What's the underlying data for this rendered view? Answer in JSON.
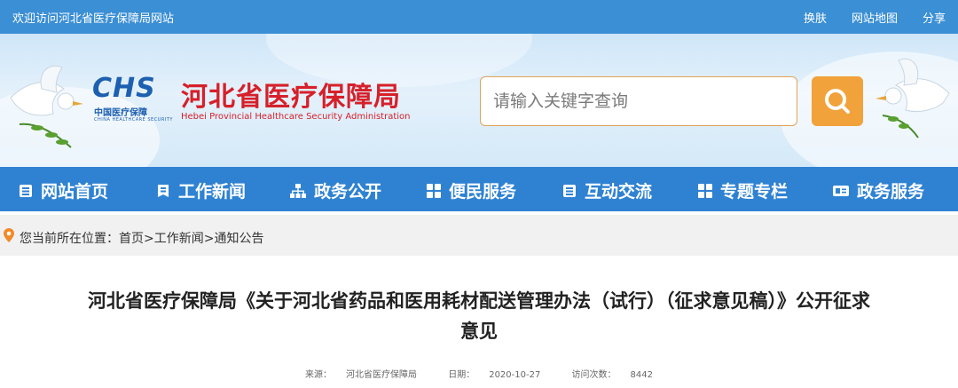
{
  "topbar": {
    "welcome": "欢迎访问河北省医疗保障局网站",
    "links": [
      "换肤",
      "网站地图",
      "分享"
    ]
  },
  "header": {
    "logo_mark": "CHS",
    "logo_sub": "中国医疗保障",
    "logo_sub_en": "CHINA HEALTHCARE SECURITY",
    "site_name": "河北省医疗保障局",
    "site_name_en": "Hebei Provincial Healthcare Security Administration",
    "search_placeholder": "请输入关键字查询",
    "search_icon": "search-icon"
  },
  "nav": {
    "items": [
      {
        "label": "网站首页",
        "icon": "document-list-icon"
      },
      {
        "label": "工作新闻",
        "icon": "bookmark-doc-icon"
      },
      {
        "label": "政务公开",
        "icon": "sitemap-icon"
      },
      {
        "label": "便民服务",
        "icon": "grid-icon"
      },
      {
        "label": "互动交流",
        "icon": "document-list-icon"
      },
      {
        "label": "专题专栏",
        "icon": "grid-icon"
      },
      {
        "label": "政务服务",
        "icon": "id-card-icon"
      }
    ]
  },
  "breadcrumb": {
    "prefix": "您当前所在位置：",
    "items": [
      "首页",
      "工作新闻",
      "通知公告"
    ],
    "separator": ">"
  },
  "article": {
    "title_line1": "河北省医疗保障局《关于河北省药品和医用耗材配送管理办法（试行）（征求意见稿）》公开征求",
    "title_line2": "意见",
    "source_label": "来源：",
    "source": "河北省医疗保障局",
    "date_label": "日期：",
    "date": "2020-10-27",
    "views_label": "访问次数：",
    "views": "8442"
  },
  "colors": {
    "topbar": "#3b8fd4",
    "nav": "#2f82d2",
    "accent": "#f1a23a",
    "brand_red": "#d6202a",
    "brand_blue": "#1d5fb0"
  }
}
